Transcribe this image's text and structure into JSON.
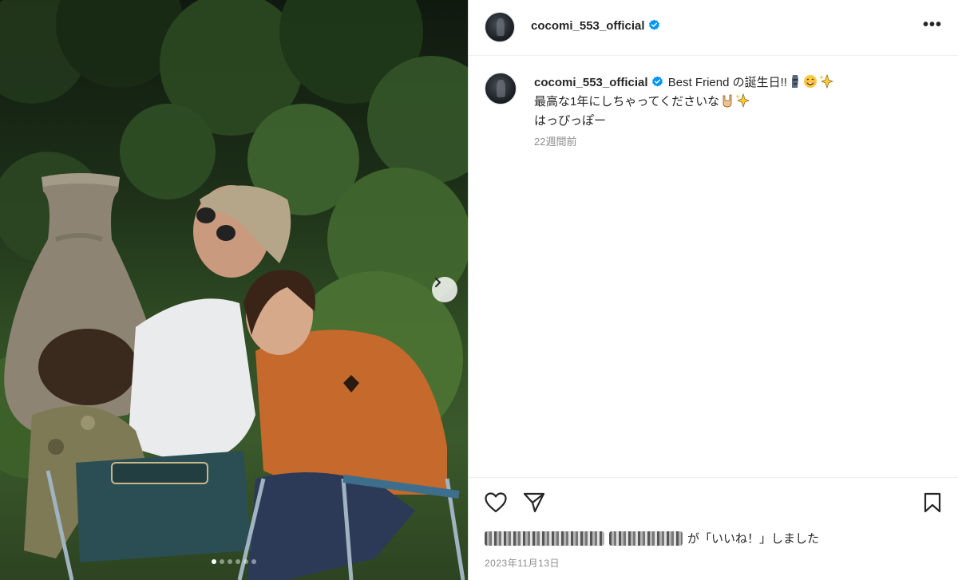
{
  "post": {
    "username": "cocomi_553_official",
    "more_label": "•••",
    "caption_lines": [
      "Best Friend の誕生日!!",
      "最高な1年にしちゃってくださいな",
      "はっぴっぽー"
    ],
    "time_ago": "22週間前",
    "liked_suffix": "が「いいね！」しました",
    "date": "2023年11月13日",
    "carousel": {
      "slides": 6,
      "active_index": 0
    }
  },
  "icons": {
    "verified": "verified-badge-icon",
    "like": "heart-outline-icon",
    "share": "paper-plane-icon",
    "save": "bookmark-outline-icon",
    "next": "chevron-right-icon"
  },
  "colors": {
    "verified": "#0095f6",
    "text": "#262626",
    "muted": "#8e8e8e",
    "border": "#dbdbdb"
  }
}
